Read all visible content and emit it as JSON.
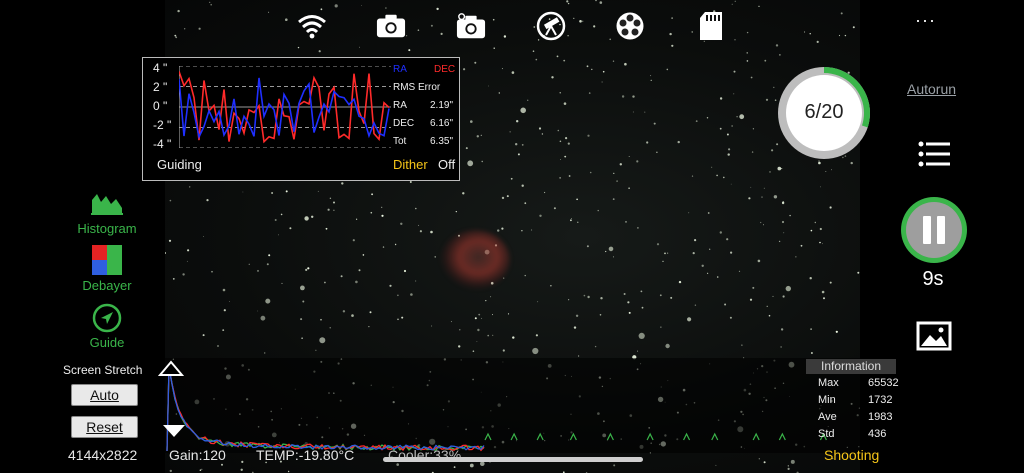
{
  "toolbar": {
    "icons": [
      "wifi-icon",
      "camera-icon",
      "camera-settings-icon",
      "telescope-icon",
      "filter-wheel-icon",
      "sd-card-icon"
    ],
    "more_label": "···"
  },
  "guiding": {
    "y_ticks": [
      "4 \"",
      "2 \"",
      "0 \"",
      "-2 \"",
      "-4 \""
    ],
    "legend_ra": "RA",
    "legend_dec": "DEC",
    "rms_label": "RMS Error",
    "ra_label": "RA",
    "ra_value": "2.19\"",
    "dec_label": "DEC",
    "dec_value": "6.16\"",
    "tot_label": "Tot",
    "tot_value": "6.35\"",
    "title": "Guiding",
    "dither_label": "Dither",
    "dither_state": "Off",
    "colors": {
      "ra": "#1f2fff",
      "dec": "#ff2a2a",
      "dither": "#f5c518"
    }
  },
  "left_panel": {
    "histogram_label": "Histogram",
    "debayer_label": "Debayer",
    "guide_label": "Guide",
    "screen_stretch_label": "Screen Stretch",
    "auto_label": "Auto",
    "reset_label": "Reset",
    "accent": "#3ab54a"
  },
  "status_bar": {
    "resolution": "4144x2822",
    "gain": "Gain:120",
    "temp": "TEMP:-19.80°C",
    "cooler": "Cooler:33%",
    "state": "Shooting",
    "state_color": "#f5c518"
  },
  "information": {
    "title": "Information",
    "rows": [
      {
        "label": "Max",
        "value": "65532"
      },
      {
        "label": "Min",
        "value": "1732"
      },
      {
        "label": "Ave",
        "value": "1983"
      },
      {
        "label": "Std",
        "value": "436"
      }
    ]
  },
  "right_panel": {
    "autorun_label": "Autorun",
    "progress_text": "6/20",
    "progress_fraction": 0.3,
    "countdown": "9s",
    "accent": "#3ab54a"
  }
}
